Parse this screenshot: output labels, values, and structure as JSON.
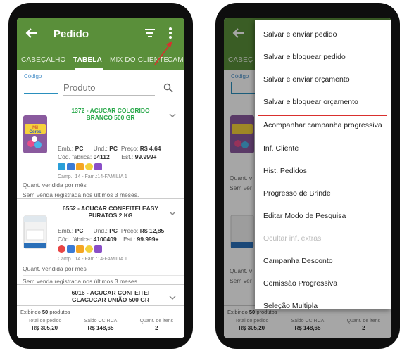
{
  "appbar": {
    "title": "Pedido"
  },
  "tabs": [
    "CABEÇALHO",
    "TABELA",
    "MIX DO CLIENTE",
    "CAMP"
  ],
  "tabs_right": {
    "cabecalho_partial": "CABEÇ"
  },
  "search": {
    "codigo_label": "Código",
    "produto_placeholder": "Produto"
  },
  "products": [
    {
      "title": "1372 - ACUCAR COLORIDO BRANCO 500 GR",
      "emb_label": "Emb.:",
      "emb": "PC",
      "und_label": "Und.:",
      "und": "PC",
      "preco_label": "Preço:",
      "preco": "R$ 4,64",
      "cod_label": "Cód. fábrica:",
      "cod": "04112",
      "est_label": "Est.:",
      "est": "99.999+",
      "camp": "Camp.: 14 - Fam.:14-FAMILIA 1",
      "qty_label": "Quant. vendida por mês",
      "qty_note": "Sem venda registrada nos últimos 3 meses."
    },
    {
      "title": "6552 - ACUCAR CONFEITEI EASY PURATOS 2 KG",
      "emb_label": "Emb.:",
      "emb": "PC",
      "und_label": "Und.:",
      "und": "PC",
      "preco_label": "Preço:",
      "preco": "R$ 12,85",
      "cod_label": "Cód. fábrica:",
      "cod": "4100409",
      "est_label": "Est.:",
      "est": "99.999+",
      "camp": "Camp.: 14 - Fam.:14-FAMILIA 1",
      "qty_label": "Quant. vendida por mês",
      "qty_note": "Sem venda registrada nos últimos 3 meses."
    },
    {
      "title": "6016 - ACUCAR CONFEITEI GLACUCAR UNIÃO 500 GR"
    }
  ],
  "product_brand": {
    "mil_cores_top": "Mil",
    "mil_cores_bottom": "Cores"
  },
  "right_partials": {
    "qty": "Quant. v",
    "sem": "Sem ver",
    "qty2": "Quant. v",
    "sem2": "Sem ver"
  },
  "footer": {
    "exibindo_prefix": "Exibindo",
    "exibindo_count": "50",
    "exibindo_suffix": "produtos",
    "total_label": "Total do pedido",
    "total_value": "R$ 305,20",
    "saldo_label": "Saldo CC RCA",
    "saldo_value": "R$ 148,65",
    "itens_label": "Quant. de itens",
    "itens_value": "2"
  },
  "menu": {
    "items": [
      "Salvar e enviar pedido",
      "Salvar e bloquear pedido",
      "Salvar e enviar orçamento",
      "Salvar e bloquear orçamento",
      "Acompanhar campanha progressiva",
      "Inf. Cliente",
      "Hist. Pedidos",
      "Progresso de Brinde",
      "Editar Modo de Pesquisa",
      "Ocultar inf. extras",
      "Campanha Desconto",
      "Comissão Progressiva",
      "Seleção Multipla"
    ],
    "highlight_index": 4,
    "disabled_index": 9
  },
  "colors": {
    "appbar": "#5a8f3a",
    "highlight_border": "#d9302e",
    "title_green": "#29a84a"
  },
  "icons": [
    "back-arrow-icon",
    "filter-icon",
    "more-vert-icon",
    "search-icon",
    "chevron-down-icon"
  ]
}
